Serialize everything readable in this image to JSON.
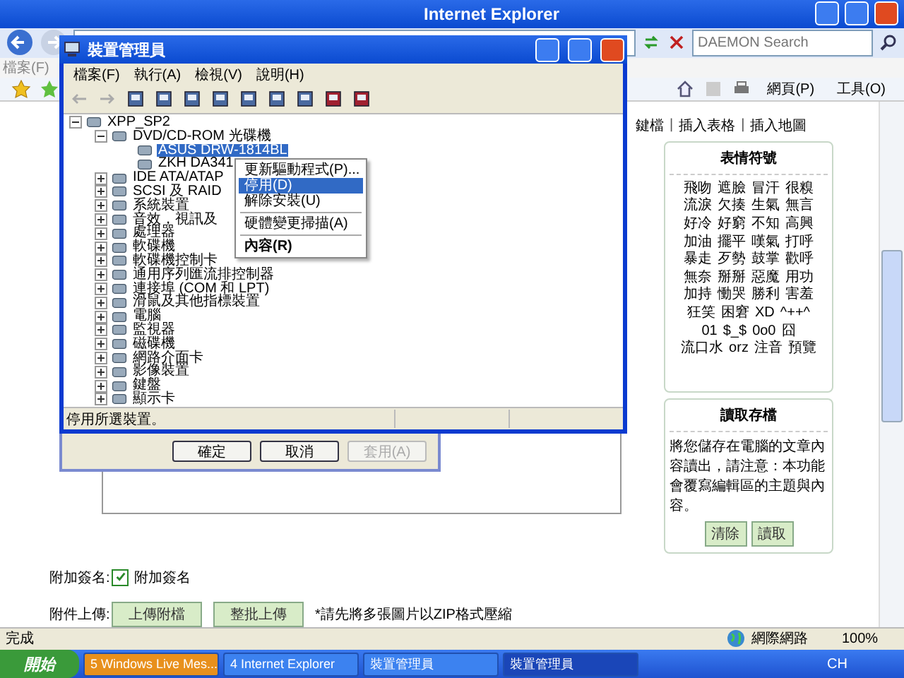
{
  "browser": {
    "title": "Internet Explorer",
    "search_placeholder": "DAEMON Search",
    "menu": [
      "檔案(F)"
    ],
    "command_buttons": [
      "網頁(P)",
      "工具(O)"
    ]
  },
  "editor_links": [
    "鍵檔",
    "插入表格",
    "插入地圖"
  ],
  "editor_link_separator": "|",
  "emoticons": {
    "title": "表情符號",
    "rows": [
      [
        "飛吻",
        "遮臉",
        "冒汗",
        "很糗"
      ],
      [
        "流淚",
        "欠揍",
        "生氣",
        "無言"
      ],
      [
        "好冷",
        "好窮",
        "不知",
        "高興"
      ],
      [
        "加油",
        "擺平",
        "嘆氣",
        "打呼"
      ],
      [
        "暴走",
        "歹勢",
        "鼓掌",
        "歡呼"
      ],
      [
        "無奈",
        "掰掰",
        "惡魔",
        "用功"
      ],
      [
        "加持",
        "慟哭",
        "勝利",
        "害羞"
      ],
      [
        "狂笑",
        "困窘",
        "XD",
        "^++^"
      ],
      [
        "01",
        "$_$",
        "0o0",
        "囧"
      ],
      [
        "流口水",
        "orz",
        "注音",
        "預覽"
      ]
    ]
  },
  "load_panel": {
    "title": "讀取存檔",
    "text": "將您儲存在電腦的文章內容讀出，請注意：本功能會覆寫編輯區的主題與內容。",
    "buttons": [
      "清除",
      "讀取"
    ]
  },
  "signature": {
    "label": "附加簽名:",
    "checkbox_label": "附加簽名",
    "checked": true
  },
  "attachment": {
    "label": "附件上傳:",
    "buttons": [
      "上傳附檔",
      "整批上傳"
    ],
    "note": "*請先將多張圖片以ZIP格式壓縮"
  },
  "status_bar": {
    "text": "完成",
    "zone": "網際網路",
    "zoom": "100%"
  },
  "back_dialog": {
    "buttons": [
      {
        "label": "確定",
        "disabled": false
      },
      {
        "label": "取消",
        "disabled": false
      },
      {
        "label": "套用(A)",
        "disabled": true
      }
    ]
  },
  "device_manager": {
    "title": "裝置管理員",
    "menu": [
      "檔案(F)",
      "執行(A)",
      "檢視(V)",
      "說明(H)"
    ],
    "tree": {
      "label": "XPP_SP2",
      "expanded": true,
      "selected": false,
      "children": [
        {
          "label": "DVD/CD-ROM 光碟機",
          "expanded": true,
          "selected": false,
          "children": [
            {
              "label": "ASUS DRW-1814BL",
              "selected": true
            },
            {
              "label": "ZKH DA341",
              "selected": false
            }
          ]
        },
        {
          "label": "IDE ATA/ATAP",
          "expanded": false,
          "selected": false
        },
        {
          "label": "SCSI 及 RAID",
          "expanded": false,
          "selected": false
        },
        {
          "label": "系統裝置",
          "expanded": false,
          "selected": false
        },
        {
          "label": "音效，視訊及",
          "expanded": false,
          "selected": false
        },
        {
          "label": "處理器",
          "expanded": false,
          "selected": false
        },
        {
          "label": "軟碟機",
          "expanded": false,
          "selected": false
        },
        {
          "label": "軟碟機控制卡",
          "expanded": false,
          "selected": false
        },
        {
          "label": "通用序列匯流排控制器",
          "expanded": false,
          "selected": false
        },
        {
          "label": "連接埠 (COM 和 LPT)",
          "expanded": false,
          "selected": false
        },
        {
          "label": "滑鼠及其他指標裝置",
          "expanded": false,
          "selected": false
        },
        {
          "label": "電腦",
          "expanded": false,
          "selected": false
        },
        {
          "label": "監視器",
          "expanded": false,
          "selected": false
        },
        {
          "label": "磁碟機",
          "expanded": false,
          "selected": false
        },
        {
          "label": "網路介面卡",
          "expanded": false,
          "selected": false
        },
        {
          "label": "影像裝置",
          "expanded": false,
          "selected": false
        },
        {
          "label": "鍵盤",
          "expanded": false,
          "selected": false
        },
        {
          "label": "顯示卡",
          "expanded": false,
          "selected": false
        }
      ]
    },
    "status": "停用所選裝置。"
  },
  "context_menu": {
    "items": [
      {
        "kind": "item",
        "label": "更新驅動程式(P)...",
        "selected": false,
        "default": false
      },
      {
        "kind": "item",
        "label": "停用(D)",
        "selected": true,
        "default": false
      },
      {
        "kind": "item",
        "label": "解除安裝(U)",
        "selected": false,
        "default": false
      },
      {
        "kind": "separator"
      },
      {
        "kind": "item",
        "label": "硬體變更掃描(A)",
        "selected": false,
        "default": false
      },
      {
        "kind": "separator"
      },
      {
        "kind": "item",
        "label": "內容(R)",
        "selected": false,
        "default": true
      }
    ]
  },
  "taskbar": {
    "start": "開始",
    "tasks": [
      {
        "label": "5 Windows Live Mes...",
        "selected": false,
        "kind": "group"
      },
      {
        "label": "4 Internet Explorer",
        "selected": false,
        "kind": "group"
      },
      {
        "label": "裝置管理員",
        "selected": false,
        "kind": "window"
      },
      {
        "label": "裝置管理員",
        "selected": true,
        "kind": "window"
      }
    ],
    "tray": "CH"
  }
}
